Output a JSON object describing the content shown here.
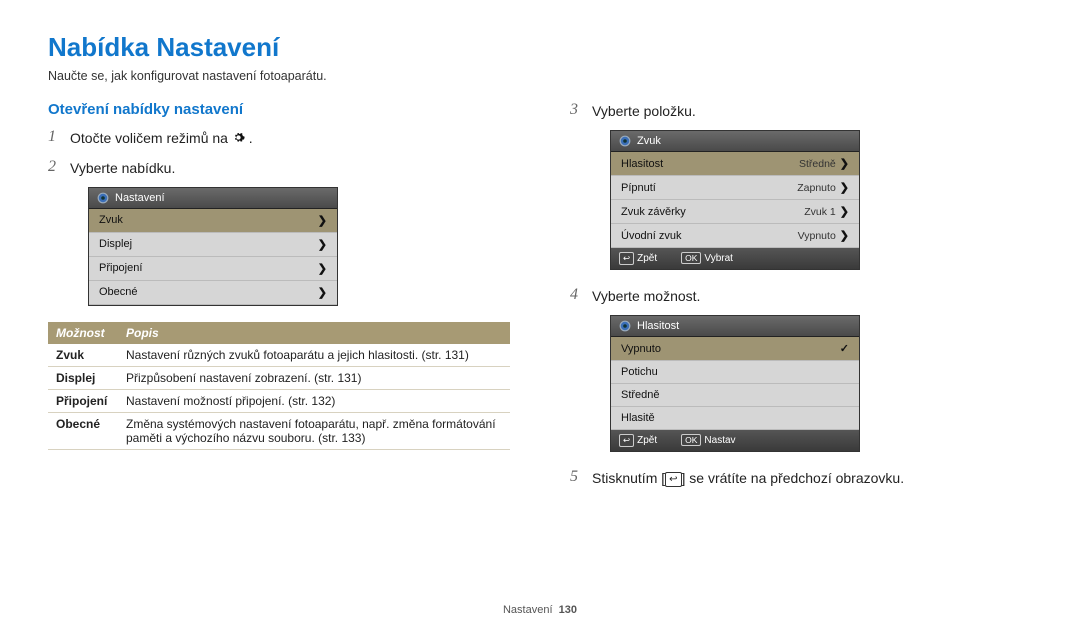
{
  "title": "Nabídka Nastavení",
  "subtitle": "Naučte se, jak konfigurovat nastavení fotoaparátu.",
  "section_title": "Otevření nabídky nastavení",
  "steps": {
    "s1_a": "Otočte voličem režimů na ",
    "s1_b": " .",
    "s2": "Vyberte nabídku.",
    "s3": "Vyberte položku.",
    "s4": "Vyberte možnost.",
    "s5_a": "Stisknutím [",
    "s5_b": "] se vrátíte na předchozí obrazovku."
  },
  "lcd1": {
    "header": "Nastavení",
    "rows": [
      "Zvuk",
      "Displej",
      "Připojení",
      "Obecné"
    ]
  },
  "lcd2": {
    "header": "Zvuk",
    "rows": [
      {
        "label": "Hlasitost",
        "value": "Středně"
      },
      {
        "label": "Pípnutí",
        "value": "Zapnuto"
      },
      {
        "label": "Zvuk závěrky",
        "value": "Zvuk 1"
      },
      {
        "label": "Úvodní zvuk",
        "value": "Vypnuto"
      }
    ],
    "footer": {
      "back": "Zpět",
      "ok": "Vybrat"
    }
  },
  "lcd3": {
    "header": "Hlasitost",
    "rows": [
      "Vypnuto",
      "Potichu",
      "Středně",
      "Hlasitě"
    ],
    "footer": {
      "back": "Zpět",
      "ok": "Nastav"
    }
  },
  "table": {
    "head_option": "Možnost",
    "head_desc": "Popis",
    "rows": [
      {
        "opt": "Zvuk",
        "desc": "Nastavení různých zvuků fotoaparátu a jejich hlasitosti. (str. 131)"
      },
      {
        "opt": "Displej",
        "desc": "Přizpůsobení nastavení zobrazení. (str. 131)"
      },
      {
        "opt": "Připojení",
        "desc": "Nastavení možností připojení. (str. 132)"
      },
      {
        "opt": "Obecné",
        "desc": "Změna systémových nastavení fotoaparátu, např. změna formátování paměti a výchozího názvu souboru. (str. 133)"
      }
    ]
  },
  "back_glyph": "↩",
  "ok_key": "OK",
  "back_key": "↩",
  "footer": {
    "section": "Nastavení",
    "page": "130"
  }
}
